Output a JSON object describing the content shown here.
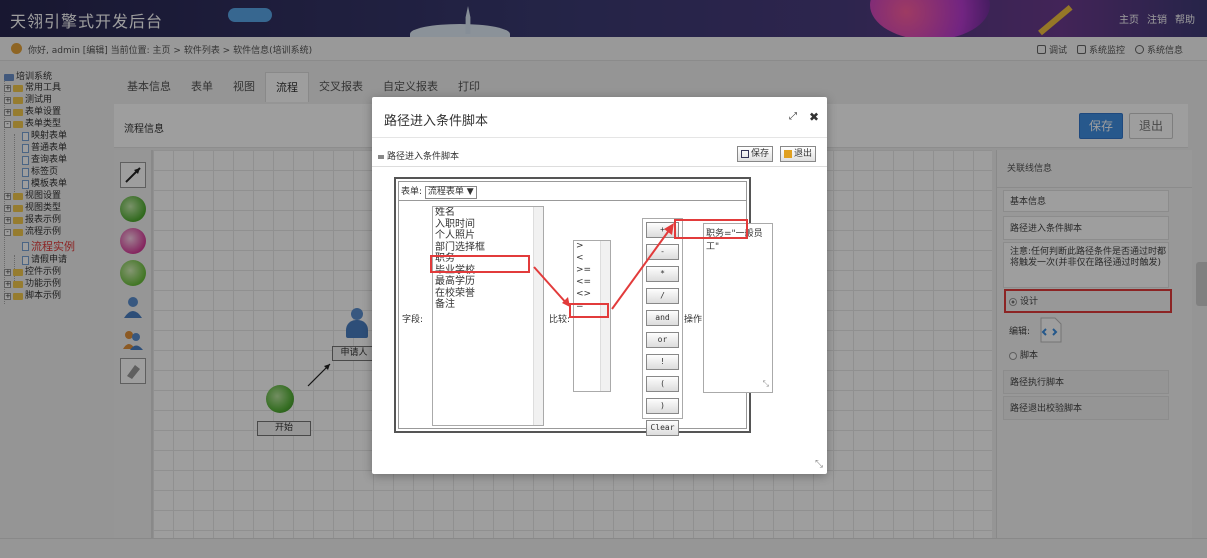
{
  "header": {
    "app_title": "天翎引擎式开发后台",
    "nav": [
      "主页",
      "注销",
      "帮助"
    ]
  },
  "infobar": {
    "greeting": "你好, admin [编辑]  当前位置: 主页 > 软件列表 > 软件信息(培训系统)",
    "tools": [
      "调试",
      "系统监控",
      "系统信息"
    ]
  },
  "tree": {
    "root": "培训系统",
    "items": [
      "常用工具",
      "测试用",
      "表单设置",
      "表单类型",
      "映射表单",
      "普通表单",
      "查询表单",
      "标签页",
      "模板表单",
      "视图设置",
      "视图类型",
      "报表示例",
      "流程示例",
      "流程实例",
      "请假申请",
      "控件示例",
      "功能示例",
      "脚本示例"
    ]
  },
  "tabs": [
    "基本信息",
    "表单",
    "视图",
    "流程",
    "交叉报表",
    "自定义报表",
    "打印"
  ],
  "panel": {
    "title": "流程信息",
    "save": "保存",
    "exit": "退出"
  },
  "canvas": {
    "node_applicant": "申请人",
    "node_start": "开始"
  },
  "props": {
    "header": "关联线信息",
    "basic": "基本信息",
    "entry_script": "路径进入条件脚本",
    "note": "注意:任何判断此路径条件是否通过时都将触发一次(并非仅在路径通过时触发)",
    "design": "设计",
    "edit": "编辑:",
    "script": "脚本",
    "exec_script": "路径执行脚本",
    "exit_script": "路径退出校验脚本"
  },
  "modal": {
    "title": "路径进入条件脚本",
    "subhead": "路径进入条件脚本",
    "save": "保存",
    "exit": "退出",
    "form_label": "表单:",
    "form_value": "流程表单",
    "field_label": "字段:",
    "compare_label": "比较:",
    "op_label": "操作:",
    "fields": [
      "姓名",
      "入职时间",
      "个人照片",
      "部门选择框",
      "职务",
      "毕业学校",
      "最高学历",
      "在校荣誉",
      "备注"
    ],
    "comparators": [
      ">",
      "<",
      ">=",
      "<=",
      "<>",
      "="
    ],
    "operators": [
      "+",
      "-",
      "*",
      "/",
      "and",
      "or",
      "!",
      "(",
      ")",
      "Clear"
    ],
    "expression": "职务=\"一般员工\""
  },
  "colors": {
    "accent": "#3f8ee2",
    "highlight": "#e23b3b"
  }
}
